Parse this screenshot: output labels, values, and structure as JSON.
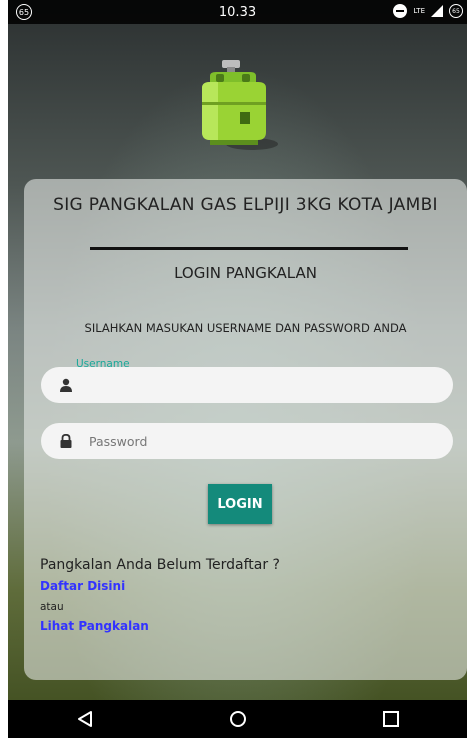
{
  "status_bar": {
    "left_badge": "65",
    "time": "10.33",
    "network": "LTE",
    "battery": "65"
  },
  "app": {
    "title": "SIG PANGKALAN GAS ELPIJI 3KG KOTA JAMBI",
    "login_heading": "LOGIN PANGKALAN",
    "instruction": "SILAHKAN MASUKAN USERNAME DAN PASSWORD ANDA"
  },
  "form": {
    "username_label": "Username",
    "username_value": "",
    "password_placeholder": "Password",
    "password_value": "",
    "login_label": "LOGIN"
  },
  "footer": {
    "register_question": "Pangkalan Anda Belum Terdaftar ?",
    "register_link": "Daftar Disini",
    "or_text": "atau",
    "view_link": "Lihat Pangkalan"
  },
  "colors": {
    "accent": "#148a7b",
    "label": "#1aa89a",
    "link": "#3333ff"
  },
  "icons": {
    "logo": "gas-cylinder-icon",
    "username": "user-icon",
    "password": "lock-icon",
    "nav_back": "back-triangle-icon",
    "nav_home": "home-circle-icon",
    "nav_recents": "recents-square-icon"
  }
}
